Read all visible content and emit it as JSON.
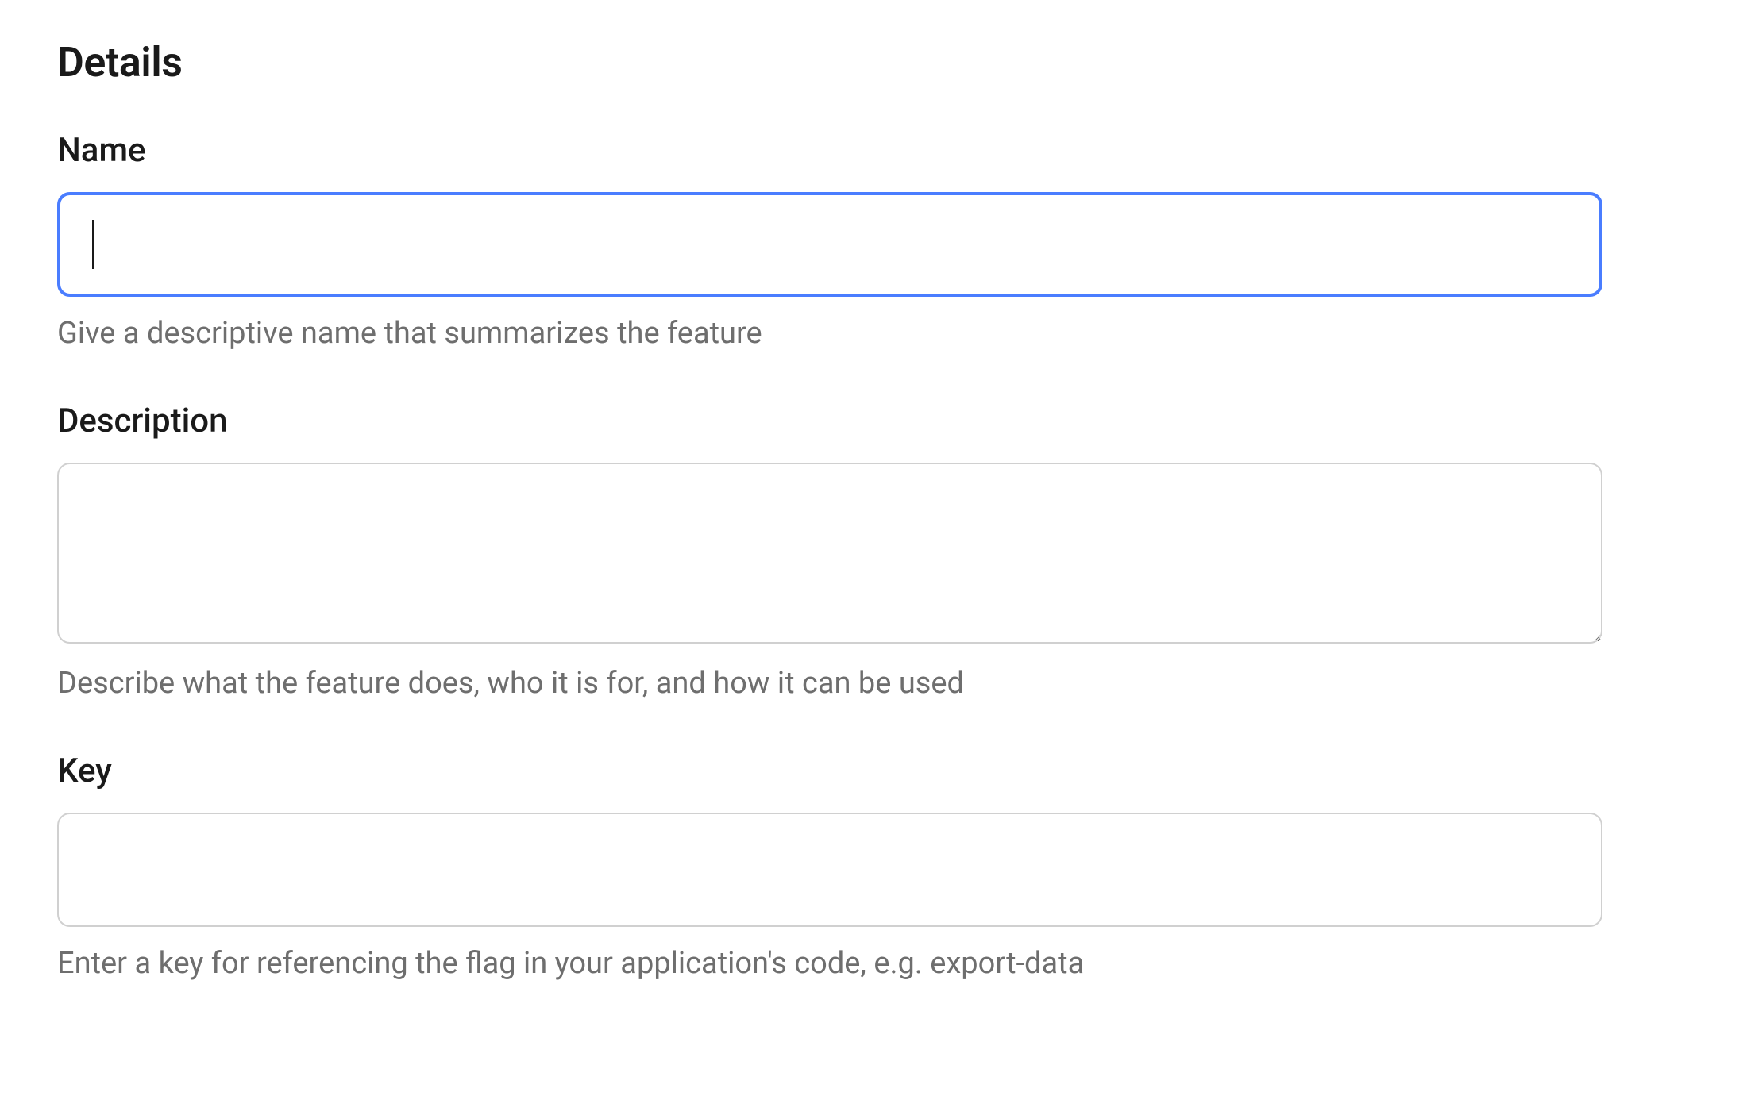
{
  "details": {
    "heading": "Details",
    "name": {
      "label": "Name",
      "value": "",
      "help": "Give a descriptive name that summarizes the feature"
    },
    "description": {
      "label": "Description",
      "value": "",
      "help": "Describe what the feature does, who it is for, and how it can be used"
    },
    "key": {
      "label": "Key",
      "value": "",
      "help": "Enter a key for referencing the flag in your application's code, e.g. export-data"
    }
  }
}
